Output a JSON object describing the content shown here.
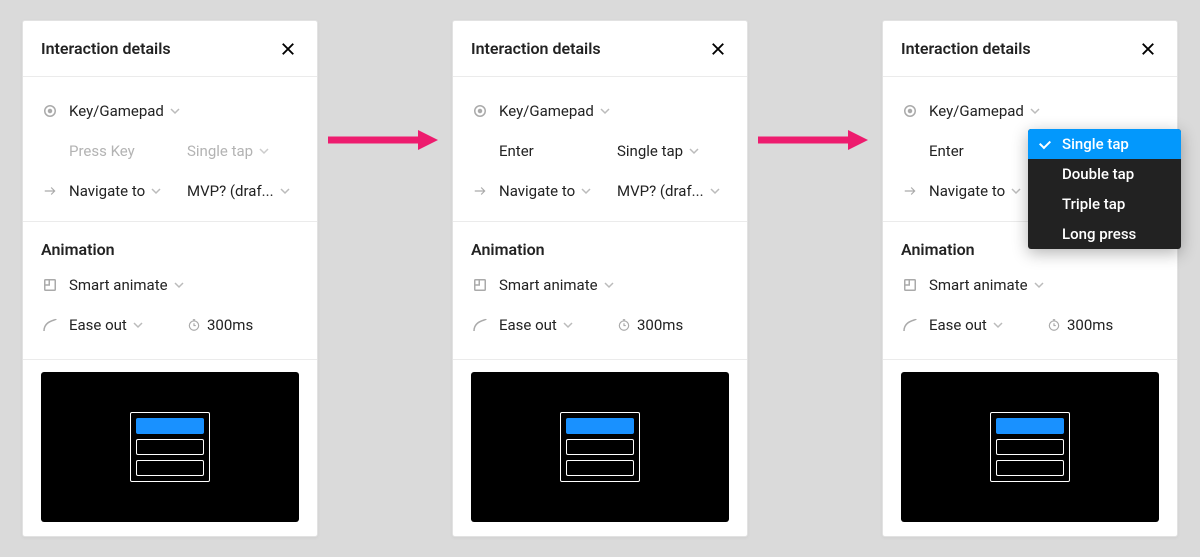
{
  "panel_title": "Interaction details",
  "trigger": {
    "type": "Key/Gamepad",
    "key_placeholder": "Press Key",
    "key_value": "Enter",
    "tap_mode": "Single tap"
  },
  "action": {
    "verb": "Navigate to",
    "target": "MVP? (draf..."
  },
  "animation": {
    "section_title": "Animation",
    "type": "Smart animate",
    "easing": "Ease out",
    "duration": "300ms"
  },
  "tap_options": [
    "Single tap",
    "Double tap",
    "Triple tap",
    "Long press"
  ],
  "tap_selected_index": 0
}
